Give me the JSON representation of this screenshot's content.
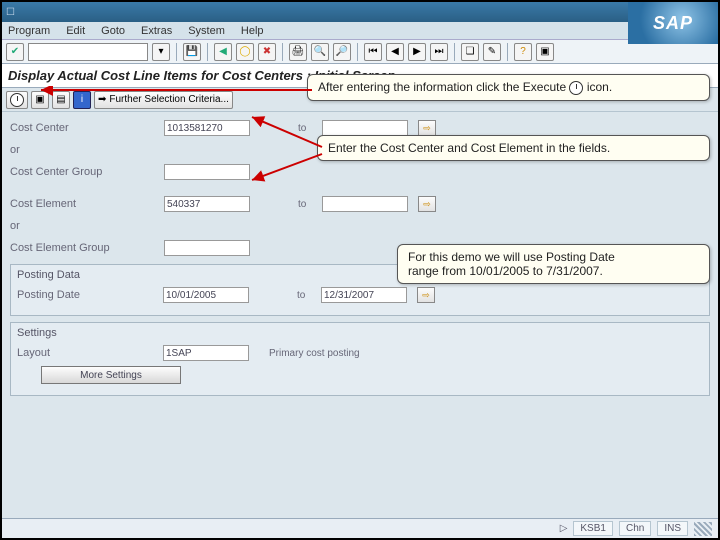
{
  "logo": "SAP",
  "menu": {
    "program": "Program",
    "edit": "Edit",
    "goto": "Goto",
    "extras": "Extras",
    "system": "System",
    "help": "Help"
  },
  "page_title": "Display Actual Cost Line Items for Cost Centers : Initial Screen",
  "app_toolbar": {
    "further": "Further Selection Criteria..."
  },
  "form": {
    "cost_center_lbl": "Cost Center",
    "cost_center_val": "1013581270",
    "or_lbl": "or",
    "cost_center_group_lbl": "Cost Center Group",
    "cost_element_lbl": "Cost Element",
    "cost_element_val": "540337",
    "cost_element_group_lbl": "Cost Element Group",
    "to_lbl": "to"
  },
  "posting": {
    "group_title": "Posting Data",
    "date_lbl": "Posting Date",
    "from": "10/01/2005",
    "to": "12/31/2007"
  },
  "settings": {
    "group_title": "Settings",
    "layout_lbl": "Layout",
    "layout_val": "1SAP",
    "layout_desc": "Primary cost posting",
    "more_btn": "More Settings"
  },
  "callouts": {
    "c1a": "After entering the information click the Execute",
    "c1b": " icon.",
    "c2": "Enter the Cost Center and Cost Element in the fields.",
    "c3a": "For this demo we will use Posting Date",
    "c3b": "range from 10/01/2005 to 7/31/2007."
  },
  "status": {
    "s1": "KSB1",
    "s2": "Chn",
    "s3": "INS"
  }
}
